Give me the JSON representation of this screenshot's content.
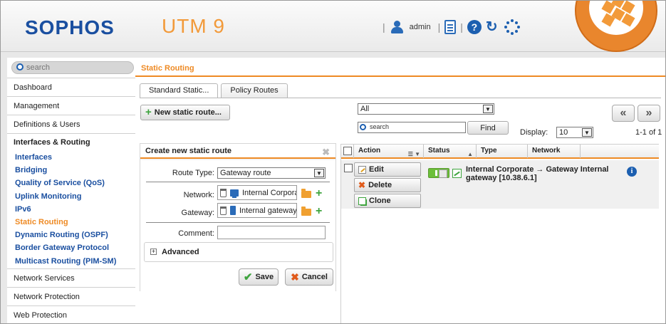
{
  "header": {
    "brand": "SOPHOS",
    "product": "UTM 9",
    "separator": "|",
    "user": "admin",
    "help_glyph": "?",
    "refresh_glyph": "↻",
    "icons": [
      "user-icon",
      "clipboard-icon",
      "help-icon",
      "refresh-icon",
      "spinner-icon",
      "sophos-logo-ring"
    ]
  },
  "sidebar": {
    "search_placeholder": "search",
    "top_items": [
      "Dashboard",
      "Management",
      "Definitions & Users"
    ],
    "section": "Interfaces & Routing",
    "sub_items": [
      "Interfaces",
      "Bridging",
      "Quality of Service (QoS)",
      "Uplink Monitoring",
      "IPv6",
      "Static Routing",
      "Dynamic Routing (OSPF)",
      "Border Gateway Protocol",
      "Multicast Routing (PIM-SM)"
    ],
    "active_sub": "Static Routing",
    "bottom_items": [
      "Network Services",
      "Network Protection",
      "Web Protection"
    ]
  },
  "main": {
    "breadcrumb": "Static Routing",
    "tabs": [
      {
        "label": "Standard Static..."
      },
      {
        "label": "Policy Routes"
      }
    ],
    "new_button": "New static route...",
    "filter_value": "All",
    "search_placeholder": "search",
    "find_label": "Find",
    "display_label": "Display:",
    "display_value": "10",
    "pager_count": "1-1 of 1",
    "pager_prev": "«",
    "pager_next": "»"
  },
  "panel": {
    "title": "Create new static route",
    "close_glyph": "✖",
    "route_type_label": "Route Type:",
    "route_type_value": "Gateway route",
    "network_label": "Network:",
    "network_value": "Internal Corporate",
    "gateway_label": "Gateway:",
    "gateway_value": "Internal gateway",
    "comment_label": "Comment:",
    "comment_value": "",
    "advanced_label": "Advanced",
    "advanced_toggle": "+",
    "save_label": "Save",
    "cancel_label": "Cancel",
    "add_glyph": "+"
  },
  "table": {
    "headers": {
      "action": "Action",
      "status": "Status",
      "type": "Type",
      "network": "Network"
    },
    "rows": [
      {
        "edit": "Edit",
        "delete": "Delete",
        "clone": "Clone",
        "description": "Internal Corporate → Gateway Internal gateway [10.38.6.1]",
        "status": "enabled",
        "info_glyph": "i"
      }
    ]
  },
  "colors": {
    "accent": "#ee8a24",
    "brand_blue": "#1a4fa0",
    "nav_link": "#1a4fa0",
    "enabled_green": "#6cbf3a"
  }
}
